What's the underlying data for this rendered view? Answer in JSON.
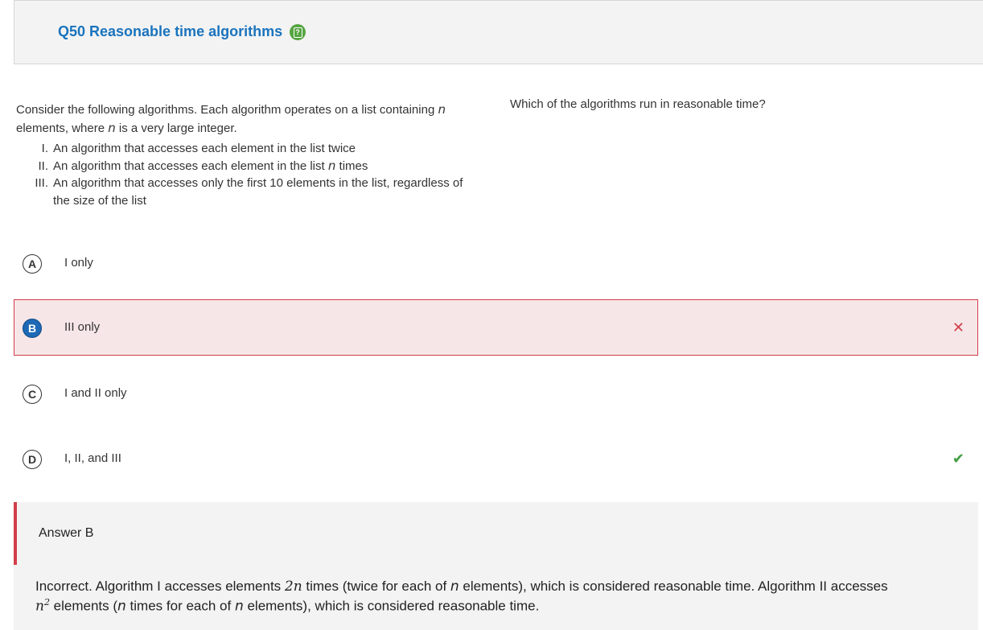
{
  "question": {
    "title": "Q50 Reasonable time algorithms",
    "intro_1": "Consider the following algorithms. Each algorithm operates on a list containing ",
    "intro_n": "n",
    "intro_2": " elements, where ",
    "intro_n2": "n",
    "intro_3": " is a very large integer.",
    "items": [
      {
        "num": "I.",
        "text": "An algorithm that accesses each element in the list twice"
      },
      {
        "num": "II.",
        "text": "An algorithm that accesses each element in the list ",
        "var": "n",
        "after": " times"
      },
      {
        "num": "III.",
        "text": "An algorithm that accesses only the first 10 elements in the list, regardless of the size of the list"
      }
    ],
    "stem": "Which of the algorithms run in reasonable time?"
  },
  "choices": [
    {
      "letter": "A",
      "text": "I only"
    },
    {
      "letter": "B",
      "text": "III only",
      "selected": true,
      "status": "incorrect",
      "status_icon": "x-icon"
    },
    {
      "letter": "C",
      "text": "I and II only"
    },
    {
      "letter": "D",
      "text": "I, II, and III",
      "status": "correct",
      "status_icon": "check-icon"
    }
  ],
  "answer": {
    "label": "Answer B",
    "exp_1": "Incorrect. Algorithm I accesses elements ",
    "exp_2n": "2n",
    "exp_3": " times (twice for each of ",
    "exp_n1": "n",
    "exp_4": " elements), which is considered reasonable time. Algorithm II accesses",
    "exp_n2": "n",
    "exp_sup": "2",
    "exp_5": " elements (",
    "exp_n3": "n",
    "exp_6": " times for each of ",
    "exp_n4": "n",
    "exp_7": " elements), which is considered reasonable time."
  },
  "colors": {
    "accent": "#1a73bd",
    "incorrect": "#d23e4a",
    "correct": "#3e9c3e",
    "help_icon": "#55a540"
  }
}
